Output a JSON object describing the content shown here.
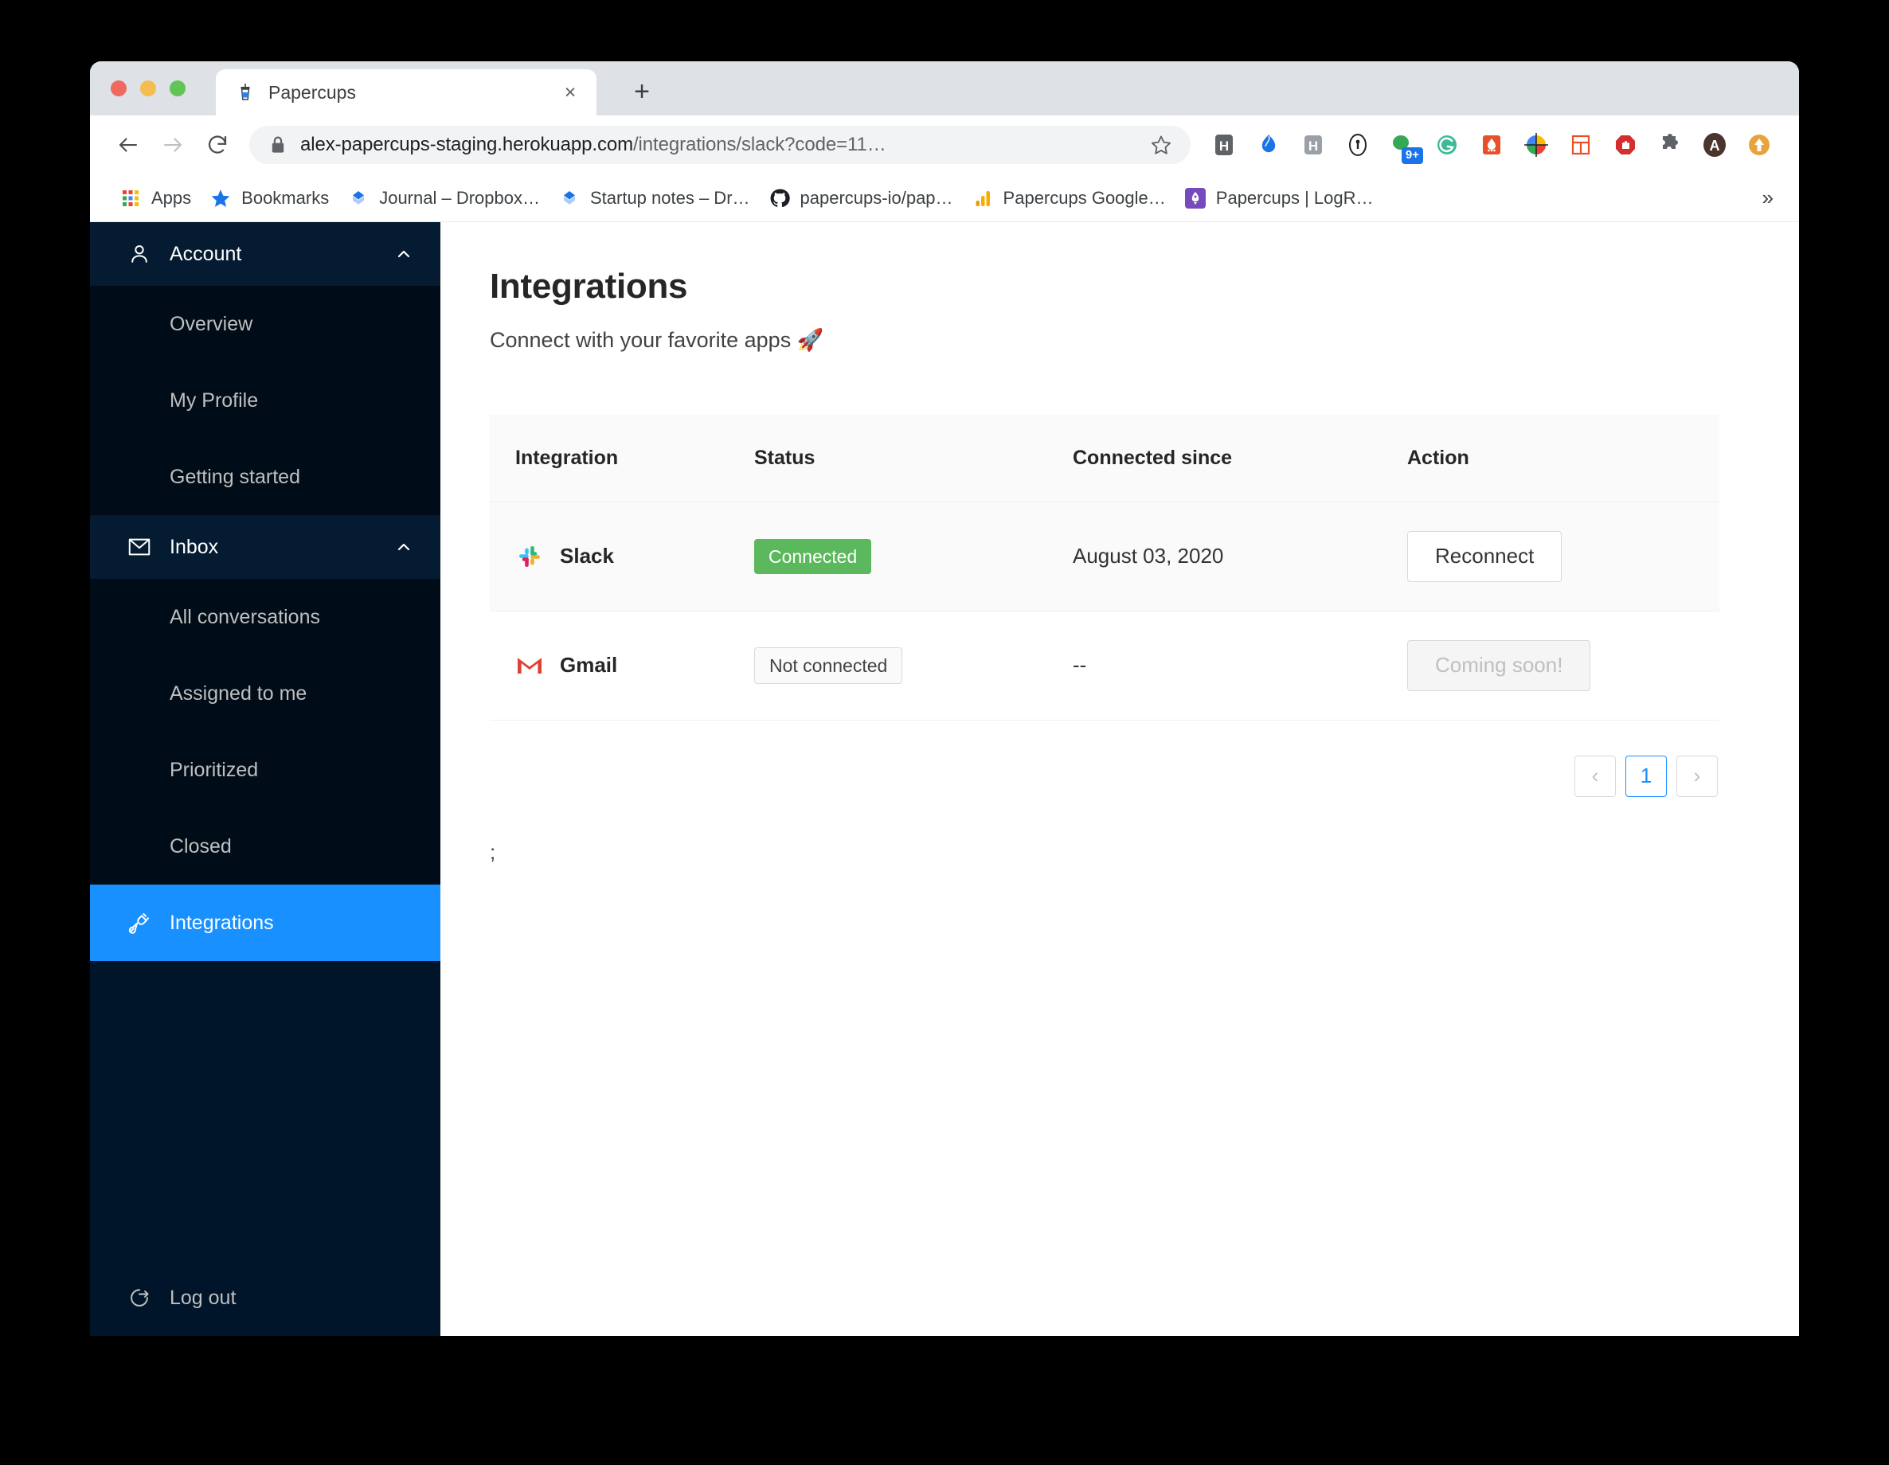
{
  "browser": {
    "tab": {
      "title": "Papercups",
      "favicon": "papercup-icon",
      "close": "×"
    },
    "new_tab": "+",
    "nav": {
      "back": "←",
      "forward": "→",
      "reload": "↻"
    },
    "omnibox": {
      "lock": "lock-icon",
      "url_bold": "alex-papercups-staging.herokuapp.com",
      "url_dim": "/integrations/slack?code=11…",
      "star": "☆"
    },
    "extensions": [
      {
        "name": "honey-extension",
        "glyph": "H"
      },
      {
        "name": "grammarly-pin-extension",
        "glyph": ""
      },
      {
        "name": "hubspot-extension",
        "glyph": "H"
      },
      {
        "name": "onepassword-extension",
        "glyph": ""
      },
      {
        "name": "notification-extension",
        "glyph": "",
        "badge": "9+"
      },
      {
        "name": "grammarly-extension",
        "glyph": "G"
      },
      {
        "name": "fireshot-extension",
        "glyph": ""
      },
      {
        "name": "colorpicker-extension",
        "glyph": ""
      },
      {
        "name": "window-resizer-extension",
        "glyph": ""
      },
      {
        "name": "adblock-extension",
        "glyph": ""
      },
      {
        "name": "puzzle-extensions-menu",
        "glyph": ""
      },
      {
        "name": "profile-avatar",
        "glyph": "A"
      },
      {
        "name": "update-browser-button",
        "glyph": "↑"
      }
    ],
    "bookmarks": [
      {
        "label": "Apps",
        "icon": "apps-grid-icon"
      },
      {
        "label": "Bookmarks",
        "icon": "star-icon"
      },
      {
        "label": "Journal – Dropbox…",
        "icon": "dropbox-icon"
      },
      {
        "label": "Startup notes – Dr…",
        "icon": "dropbox-icon"
      },
      {
        "label": "papercups-io/pap…",
        "icon": "github-icon"
      },
      {
        "label": "Papercups Google…",
        "icon": "google-analytics-icon"
      },
      {
        "label": "Papercups | LogR…",
        "icon": "logrocket-icon"
      }
    ],
    "bookmarks_overflow": "»"
  },
  "sidebar": {
    "sections": [
      {
        "label": "Account",
        "icon": "user-icon",
        "caret": "chevron-up-icon",
        "items": [
          {
            "label": "Overview"
          },
          {
            "label": "My Profile"
          },
          {
            "label": "Getting started"
          }
        ]
      },
      {
        "label": "Inbox",
        "icon": "envelope-icon",
        "caret": "chevron-up-icon",
        "items": [
          {
            "label": "All conversations"
          },
          {
            "label": "Assigned to me"
          },
          {
            "label": "Prioritized"
          },
          {
            "label": "Closed"
          }
        ]
      }
    ],
    "active_item": {
      "label": "Integrations",
      "icon": "plug-api-icon"
    },
    "logout": {
      "label": "Log out",
      "icon": "logout-icon"
    },
    "colors": {
      "bg": "#001529",
      "submenu_bg": "#000c17",
      "active": "#1890ff"
    }
  },
  "main": {
    "title": "Integrations",
    "subtitle": "Connect with your favorite apps 🚀",
    "table": {
      "columns": [
        "Integration",
        "Status",
        "Connected since",
        "Action"
      ],
      "rows": [
        {
          "integration": "Slack",
          "icon": "slack-icon",
          "status": "Connected",
          "status_type": "connected",
          "connected_since": "August 03, 2020",
          "action": "Reconnect",
          "action_disabled": false
        },
        {
          "integration": "Gmail",
          "icon": "gmail-icon",
          "status": "Not connected",
          "status_type": "not-connected",
          "connected_since": "--",
          "action": "Coming soon!",
          "action_disabled": true
        }
      ]
    },
    "pagination": {
      "prev": "‹",
      "pages": [
        "1"
      ],
      "next": "›",
      "current": "1"
    },
    "stray_text": ";"
  },
  "colors": {
    "connected_green": "#5cb85c",
    "accent_blue": "#1890ff"
  }
}
